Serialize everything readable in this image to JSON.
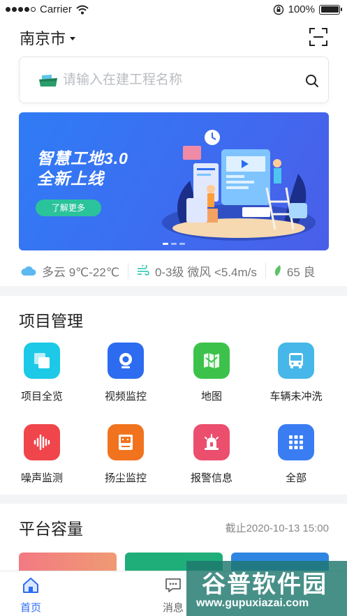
{
  "status_bar": {
    "carrier": "Carrier",
    "battery": "100%",
    "battery_level": 1.0
  },
  "header": {
    "city": "南京市"
  },
  "search": {
    "placeholder": "请输入在建工程名称"
  },
  "banner": {
    "title_line1": "智慧工地3.0",
    "title_line2": "全新上线",
    "button": "了解更多",
    "slides": 3,
    "active_slide": 0
  },
  "weather": {
    "condition": "多云 9℃-22℃",
    "wind": "0-3级 微风 <5.4m/s",
    "air": "65 良"
  },
  "project_mgmt": {
    "title": "项目管理",
    "items": [
      {
        "label": "项目全览",
        "icon": "overview-icon",
        "color": "#1cc9e6"
      },
      {
        "label": "视频监控",
        "icon": "camera-icon",
        "color": "#2d6cf0"
      },
      {
        "label": "地图",
        "icon": "map-icon",
        "color": "#3cc24a"
      },
      {
        "label": "车辆未冲洗",
        "icon": "bus-icon",
        "color": "#46b7e8"
      },
      {
        "label": "噪声监测",
        "icon": "sound-wave-icon",
        "color": "#f0464b"
      },
      {
        "label": "扬尘监控",
        "icon": "dust-monitor-icon",
        "color": "#f2731e"
      },
      {
        "label": "报警信息",
        "icon": "alarm-light-icon",
        "color": "#ec4e6e"
      },
      {
        "label": "全部",
        "icon": "grid-icon",
        "color": "#3a7df2"
      }
    ]
  },
  "capacity": {
    "title": "平台容量",
    "as_of": "截止2020-10-13 15:00"
  },
  "tabbar": {
    "home": "首页",
    "messages": "消息"
  },
  "watermark": {
    "brand": "谷普软件园",
    "url": "www.gupuxiazai.com"
  }
}
